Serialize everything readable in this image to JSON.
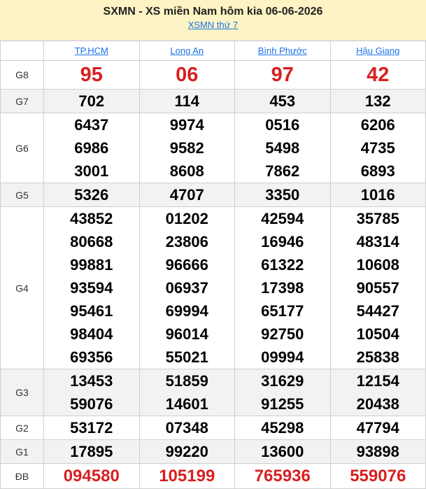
{
  "header": {
    "title": "SXMN - XS miền Nam hôm kia 06-06-2026",
    "link": "XSMN thứ 7"
  },
  "provinces": [
    "TP.HCM",
    "Long An",
    "Bình Phước",
    "Hậu Giang"
  ],
  "prizes": [
    {
      "label": "G8",
      "values": [
        [
          "95"
        ],
        [
          "06"
        ],
        [
          "97"
        ],
        [
          "42"
        ]
      ]
    },
    {
      "label": "G7",
      "values": [
        [
          "702"
        ],
        [
          "114"
        ],
        [
          "453"
        ],
        [
          "132"
        ]
      ]
    },
    {
      "label": "G6",
      "values": [
        [
          "6437",
          "6986",
          "3001"
        ],
        [
          "9974",
          "9582",
          "8608"
        ],
        [
          "0516",
          "5498",
          "7862"
        ],
        [
          "6206",
          "4735",
          "6893"
        ]
      ]
    },
    {
      "label": "G5",
      "values": [
        [
          "5326"
        ],
        [
          "4707"
        ],
        [
          "3350"
        ],
        [
          "1016"
        ]
      ]
    },
    {
      "label": "G4",
      "values": [
        [
          "43852",
          "80668",
          "99881",
          "93594",
          "95461",
          "98404",
          "69356"
        ],
        [
          "01202",
          "23806",
          "96666",
          "06937",
          "69994",
          "96014",
          "55021"
        ],
        [
          "42594",
          "16946",
          "61322",
          "17398",
          "65177",
          "92750",
          "09994"
        ],
        [
          "35785",
          "48314",
          "10608",
          "90557",
          "54427",
          "10504",
          "25838"
        ]
      ]
    },
    {
      "label": "G3",
      "values": [
        [
          "13453",
          "59076"
        ],
        [
          "51859",
          "14601"
        ],
        [
          "31629",
          "91255"
        ],
        [
          "12154",
          "20438"
        ]
      ]
    },
    {
      "label": "G2",
      "values": [
        [
          "53172"
        ],
        [
          "07348"
        ],
        [
          "45298"
        ],
        [
          "47794"
        ]
      ]
    },
    {
      "label": "G1",
      "values": [
        [
          "17895"
        ],
        [
          "99220"
        ],
        [
          "13600"
        ],
        [
          "93898"
        ]
      ]
    },
    {
      "label": "ĐB",
      "values": [
        [
          "094580"
        ],
        [
          "105199"
        ],
        [
          "765936"
        ],
        [
          "559076"
        ]
      ]
    }
  ],
  "colors": {
    "special_red": "#d81f1f",
    "link_blue": "#1a73e8",
    "header_bg": "#fdf3c4",
    "row_shade": "#f2f2f2"
  }
}
